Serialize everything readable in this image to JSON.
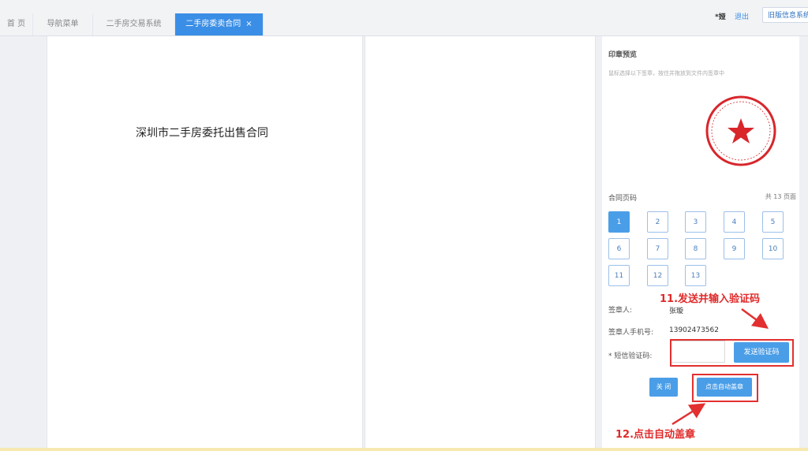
{
  "tabs": [
    {
      "label": "首 页"
    },
    {
      "label": "导航菜单"
    },
    {
      "label": "二手房交易系统"
    },
    {
      "label": "二手房委卖合同",
      "close": "×"
    }
  ],
  "user": {
    "name": "*娅",
    "logout": "退出",
    "old_system": "旧版信息系统"
  },
  "document": {
    "title": "深圳市二手房委托出售合同"
  },
  "panel": {
    "title": "印章预览",
    "hint": "鼠标选择以下签章，按住并拖放到文件内签章中",
    "pages_label": "合同页码",
    "pages_total": "共 13 页面",
    "pages": [
      "1",
      "2",
      "3",
      "4",
      "5",
      "6",
      "7",
      "8",
      "9",
      "10",
      "11",
      "12",
      "13"
    ],
    "active_page": "1",
    "signer_label": "签章人:",
    "signer_value": "张璇",
    "phone_label": "签章人手机号:",
    "phone_value": "13902473562",
    "sms_label": "* 短信验证码:",
    "sms_value": "",
    "send_btn": "发送验证码",
    "close_btn": "关 闭",
    "auto_btn": "点击自动盖章"
  },
  "annotations": {
    "step11": "11.发送并输入验证码",
    "step12": "12.点击自动盖章"
  },
  "colors": {
    "accent": "#4a9ee8",
    "annotation": "#e23030",
    "seal": "#d8262b"
  }
}
